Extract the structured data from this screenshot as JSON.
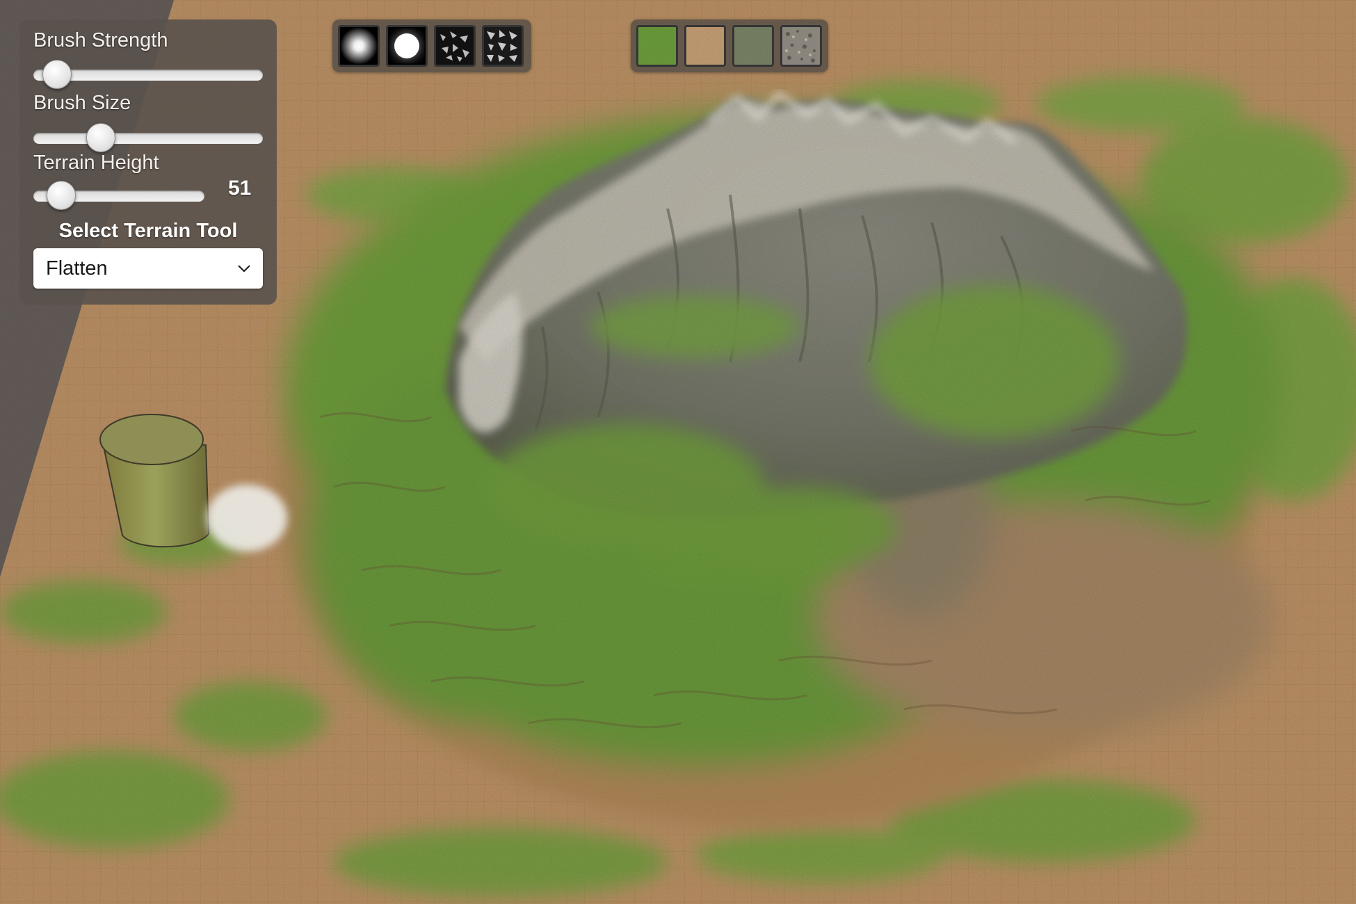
{
  "settings": {
    "brush_strength": {
      "label": "Brush Strength",
      "value": 0.1
    },
    "brush_size": {
      "label": "Brush Size",
      "value": 0.29
    },
    "terrain_height": {
      "label": "Terrain Height",
      "value": 51,
      "fraction": 0.16
    },
    "terrain_tool": {
      "title": "Select Terrain Tool",
      "selected": "Flatten"
    }
  },
  "brush_palette": [
    {
      "name": "soft-round-brush"
    },
    {
      "name": "hard-round-brush"
    },
    {
      "name": "noise-brush"
    },
    {
      "name": "rough-noise-brush"
    }
  ],
  "texture_palette": [
    {
      "name": "grass-texture",
      "color": "#6fa03d"
    },
    {
      "name": "sand-texture",
      "color": "#c9a177"
    },
    {
      "name": "moss-rock-texture",
      "color": "#7c8668"
    },
    {
      "name": "gravel-texture",
      "color": "#8a857c"
    }
  ],
  "colors": {
    "ground": "#b88e62",
    "grass": "#6e9b3c",
    "rock": "#8f8d80",
    "snow": "#d9d6cf",
    "panel": "#5a524c"
  }
}
